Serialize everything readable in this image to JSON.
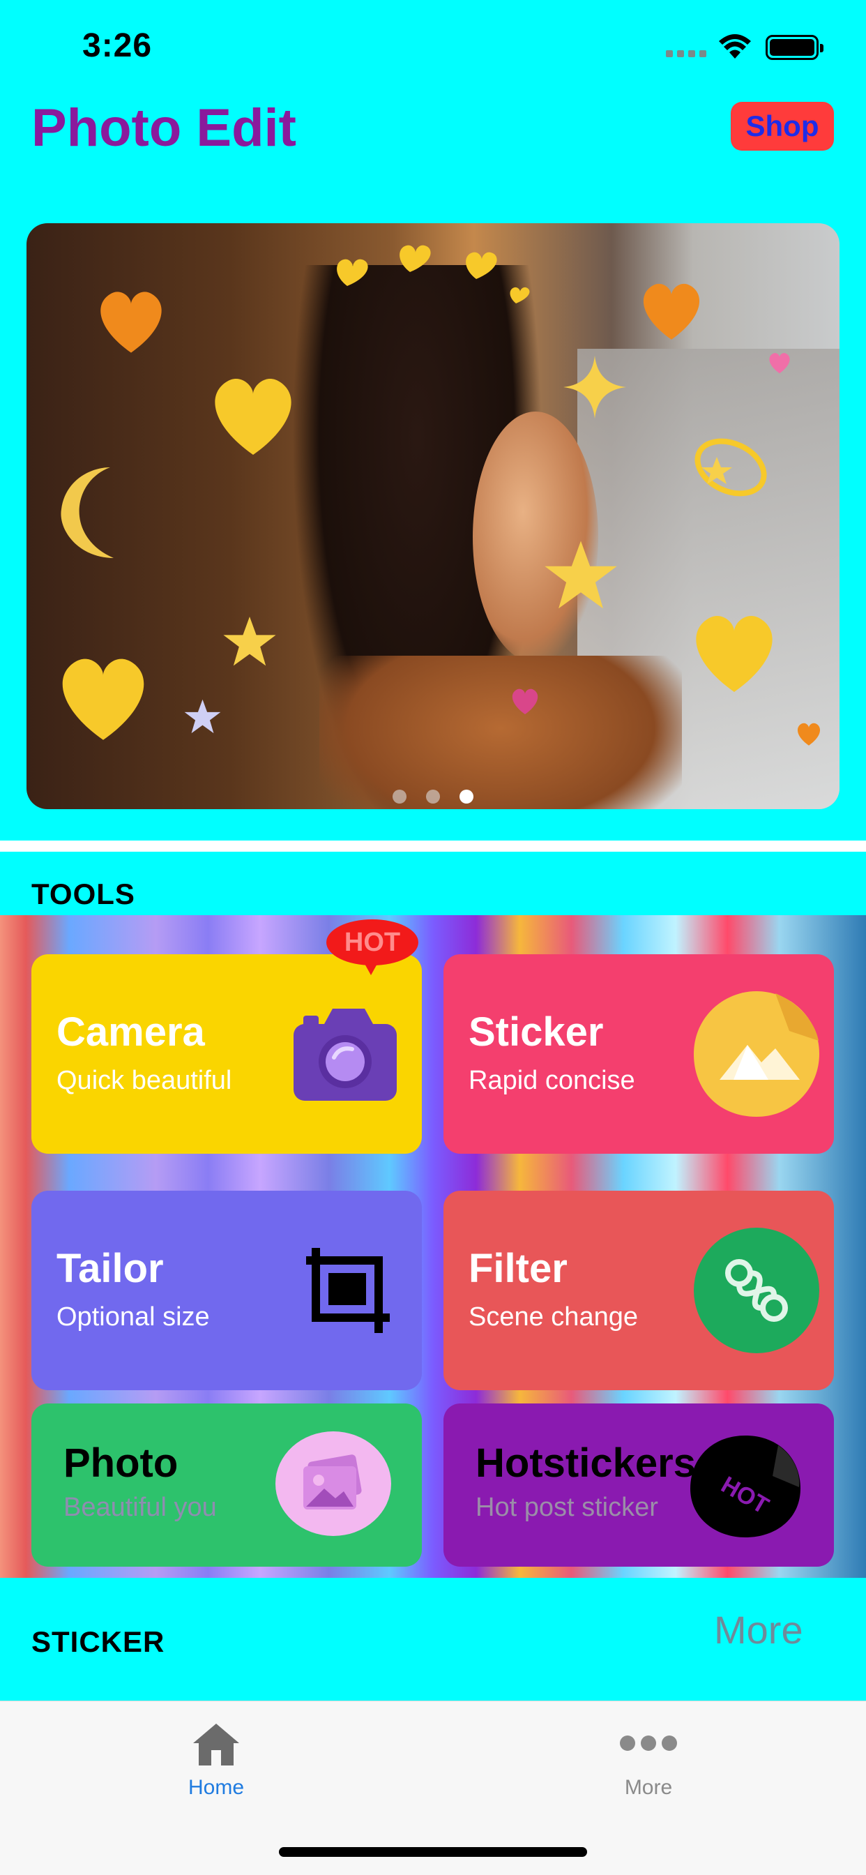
{
  "status_bar": {
    "time": "3:26"
  },
  "header": {
    "title": "Photo Edit",
    "shop_label": "Shop"
  },
  "banner": {
    "page_count": 3,
    "active_page": 3
  },
  "sections": {
    "tools": "TOOLS",
    "sticker": "STICKER",
    "more": "More"
  },
  "tools": {
    "hot_badge": "HOT",
    "camera": {
      "title": "Camera",
      "subtitle": "Quick beautiful",
      "icon": "camera-icon"
    },
    "sticker": {
      "title": "Sticker",
      "subtitle": "Rapid concise",
      "icon": "sticker-icon"
    },
    "tailor": {
      "title": "Tailor",
      "subtitle": "Optional size",
      "icon": "crop-icon"
    },
    "filter": {
      "title": "Filter",
      "subtitle": "Scene change",
      "icon": "filter-icon"
    },
    "photo": {
      "title": "Photo",
      "subtitle": "Beautiful you",
      "icon": "photo-icon"
    },
    "hotstickers": {
      "title": "Hotstickers",
      "subtitle": "Hot post sticker",
      "icon": "hot-sticker-icon",
      "icon_text": "HOT"
    }
  },
  "tab_bar": {
    "home": {
      "label": "Home",
      "icon": "home-icon",
      "active": true
    },
    "more": {
      "label": "More",
      "icon": "more-dots-icon",
      "active": false
    }
  },
  "colors": {
    "background": "#00FFFF",
    "title": "#8A1A9C",
    "shop_bg": "#FF3B3B",
    "shop_text": "#1E2CE8",
    "camera_card": "#FAD500",
    "sticker_card": "#F43F6E",
    "tailor_card": "#7169EE",
    "filter_card": "#E85658",
    "photo_card": "#2DC26C",
    "hotstickers_card": "#8A1AB0",
    "tab_active": "#1F7BE0"
  }
}
